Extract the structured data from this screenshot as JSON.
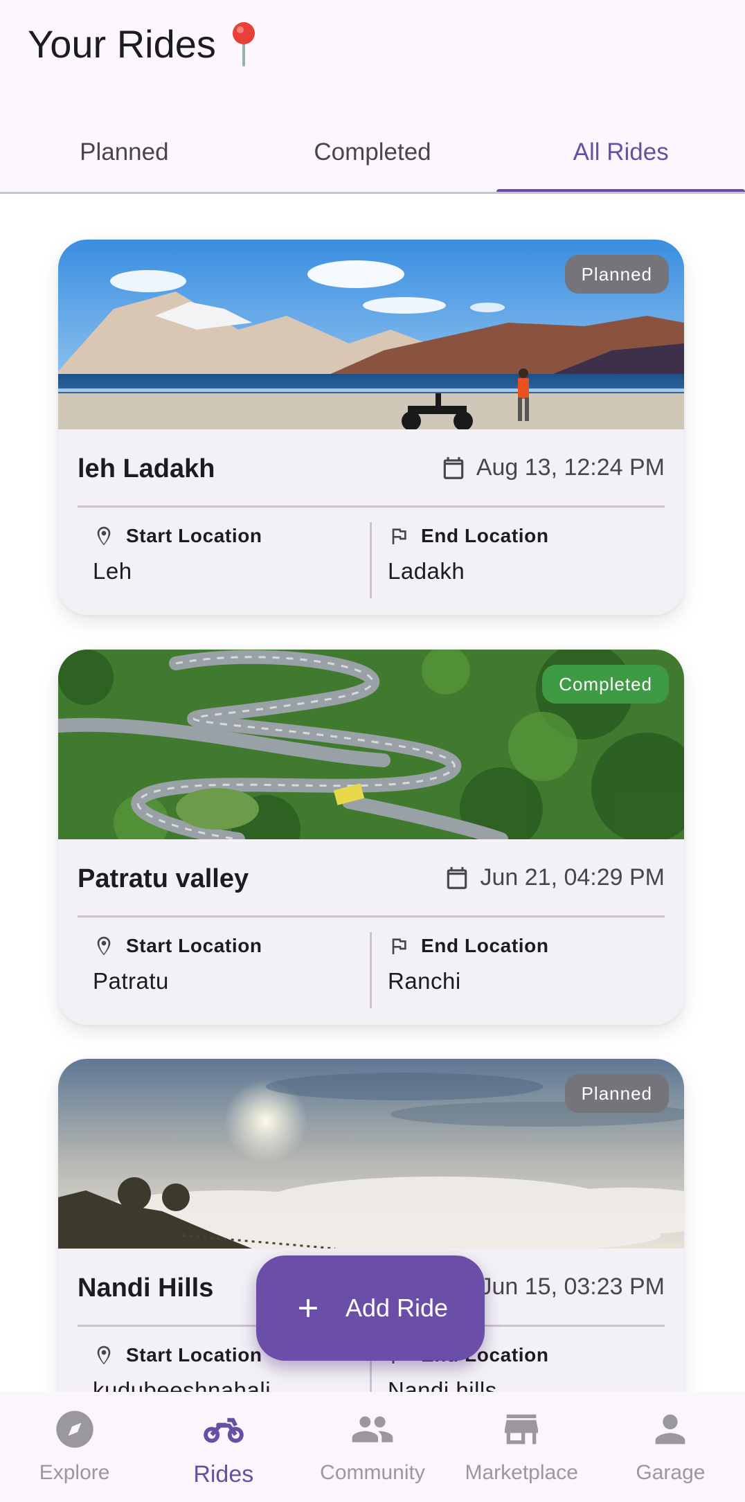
{
  "header": {
    "title": "Your Rides",
    "title_icon": "pin-icon"
  },
  "tabs": [
    {
      "label": "Planned",
      "active": false
    },
    {
      "label": "Completed",
      "active": false
    },
    {
      "label": "All Rides",
      "active": true
    }
  ],
  "colors": {
    "accent": "#6750a4",
    "planned_badge": "#74747a",
    "completed_badge": "#3f9a44",
    "card_bg": "#f3f1f6"
  },
  "rides": [
    {
      "name": "leh Ladakh",
      "date": "Aug 13, 12:24 PM",
      "status": "Planned",
      "start_label": "Start Location",
      "start": "Leh",
      "end_label": "End Location",
      "end": "Ladakh",
      "image": "lake-mountains-motorcycle"
    },
    {
      "name": "Patratu valley",
      "date": "Jun 21, 04:29 PM",
      "status": "Completed",
      "start_label": "Start Location",
      "start": "Patratu",
      "end_label": "End Location",
      "end": "Ranchi",
      "image": "winding-road-forest"
    },
    {
      "name": "Nandi Hills",
      "date": "Jun 15, 03:23 PM",
      "status": "Planned",
      "start_label": "Start Location",
      "start": "kudubeeshnahali",
      "end_label": "End Location",
      "end": "Nandi hills",
      "image": "sunrise-clouds"
    }
  ],
  "fab": {
    "label": "Add Ride",
    "icon": "plus-icon"
  },
  "bottom_nav": [
    {
      "label": "Explore",
      "icon": "compass-icon",
      "active": false
    },
    {
      "label": "Rides",
      "icon": "motorcycle-icon",
      "active": true
    },
    {
      "label": "Community",
      "icon": "people-icon",
      "active": false
    },
    {
      "label": "Marketplace",
      "icon": "store-icon",
      "active": false
    },
    {
      "label": "Garage",
      "icon": "person-icon",
      "active": false
    }
  ]
}
